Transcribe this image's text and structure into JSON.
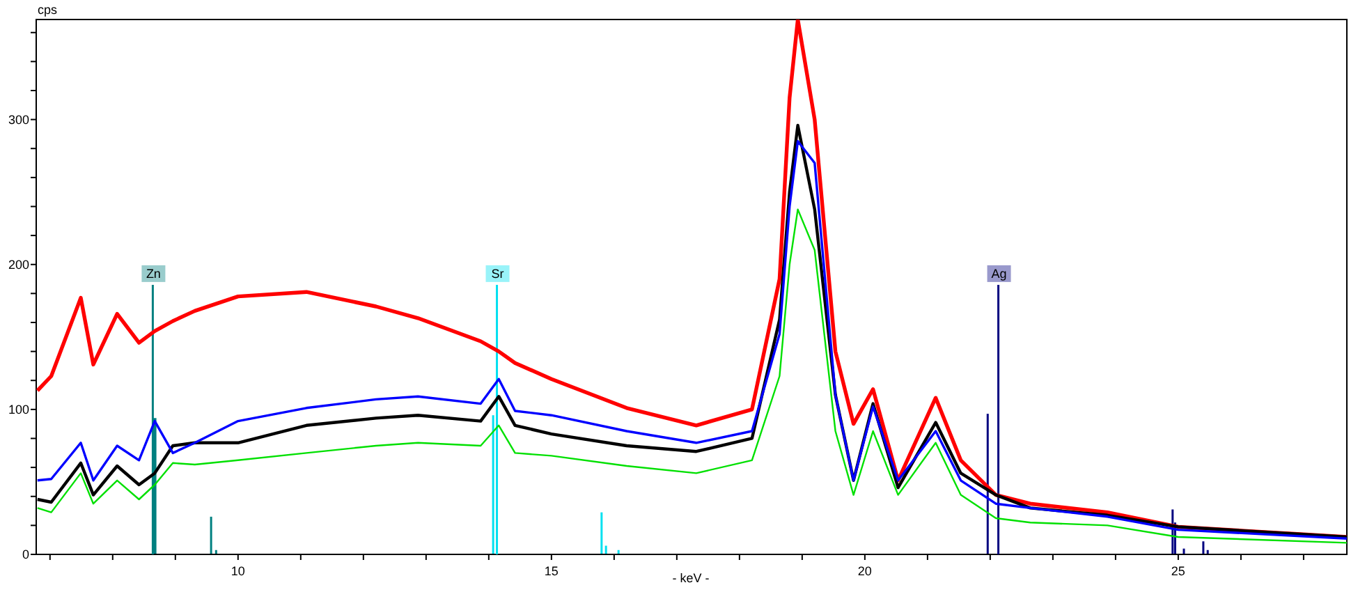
{
  "plot": {
    "chart_data": {
      "type": "line",
      "xlabel": "- keV -",
      "ylabel": "cps",
      "xlim": [
        6.78,
        27.69
      ],
      "ylim": [
        0,
        369
      ],
      "xticks": [
        10,
        15,
        20,
        25
      ],
      "yticks": [
        0,
        100,
        200,
        300
      ],
      "x": [
        6.8,
        7.02,
        7.49,
        7.69,
        8.07,
        8.42,
        8.67,
        8.96,
        9.31,
        10,
        11.09,
        12.2,
        12.87,
        13.87,
        14.16,
        14.42,
        15,
        16.2,
        17.31,
        18.2,
        18.64,
        18.8,
        18.93,
        19.2,
        19.53,
        19.82,
        20.13,
        20.53,
        21.13,
        21.53,
        22.09,
        22.64,
        23.87,
        25,
        27.69
      ],
      "series": [
        {
          "color": "#ff0000",
          "values": [
            113,
            123,
            177,
            131,
            166,
            146,
            154,
            161,
            168,
            178,
            181,
            171,
            163,
            147,
            140,
            132,
            121,
            101,
            89,
            100,
            190,
            315,
            369,
            300,
            140,
            90,
            114,
            51,
            108,
            65,
            41,
            35,
            29,
            19,
            12
          ]
        },
        {
          "color": "#000000",
          "values": [
            38,
            36,
            63,
            41,
            61,
            48,
            56,
            75,
            77,
            77,
            89,
            94,
            96,
            92,
            109,
            89,
            83,
            75,
            71,
            80,
            162,
            250,
            296,
            238,
            110,
            51,
            104,
            46,
            91,
            56,
            41,
            32,
            27,
            19,
            12
          ]
        },
        {
          "color": "#0000ff",
          "values": [
            51,
            52,
            77,
            51,
            75,
            65,
            92,
            70,
            77,
            92,
            101,
            107,
            109,
            104,
            121,
            99,
            96,
            85,
            77,
            85,
            152,
            240,
            285,
            270,
            110,
            51,
            102,
            51,
            85,
            51,
            35,
            32,
            26,
            17,
            11
          ]
        },
        {
          "color": "#00e000",
          "values": [
            32,
            29,
            56,
            35,
            51,
            38,
            48,
            63,
            62,
            65,
            70,
            75,
            77,
            75,
            89,
            70,
            68,
            61,
            56,
            65,
            123,
            200,
            238,
            210,
            85,
            41,
            85,
            41,
            77,
            41,
            25,
            22,
            20,
            12,
            8
          ]
        }
      ],
      "ref_lines": [
        {
          "axis": "x",
          "value": 8.64,
          "label": "Zn",
          "color": "#008080"
        },
        {
          "axis": "x",
          "value": 14.13,
          "label": "Sr",
          "color": "#00e0f0"
        },
        {
          "axis": "x",
          "value": 22.13,
          "label": "Ag",
          "color": "#000080"
        }
      ]
    }
  }
}
